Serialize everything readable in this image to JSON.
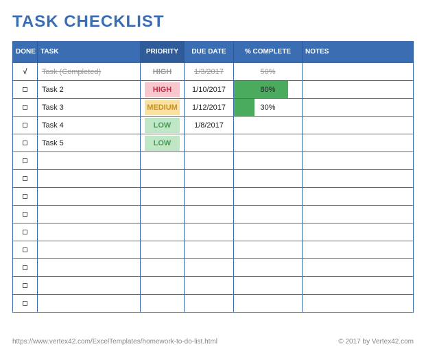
{
  "title": "TASK CHECKLIST",
  "columns": {
    "done": "DONE",
    "task": "TASK",
    "priority": "PRIORITY",
    "due": "DUE DATE",
    "pct": "% COMPLETE",
    "notes": "NOTES"
  },
  "rows": [
    {
      "done": true,
      "task": "Task (Completed)",
      "priority": "HIGH",
      "due": "1/3/2017",
      "pct": "50%",
      "pct_val": 50,
      "notes": ""
    },
    {
      "done": false,
      "task": "Task 2",
      "priority": "HIGH",
      "due": "1/10/2017",
      "pct": "80%",
      "pct_val": 80,
      "notes": ""
    },
    {
      "done": false,
      "task": "Task 3",
      "priority": "MEDIUM",
      "due": "1/12/2017",
      "pct": "30%",
      "pct_val": 30,
      "notes": ""
    },
    {
      "done": false,
      "task": "Task 4",
      "priority": "LOW",
      "due": "1/8/2017",
      "pct": "",
      "pct_val": 0,
      "notes": ""
    },
    {
      "done": false,
      "task": "Task 5",
      "priority": "LOW",
      "due": "",
      "pct": "",
      "pct_val": 0,
      "notes": ""
    },
    {
      "done": false,
      "task": "",
      "priority": "",
      "due": "",
      "pct": "",
      "pct_val": 0,
      "notes": ""
    },
    {
      "done": false,
      "task": "",
      "priority": "",
      "due": "",
      "pct": "",
      "pct_val": 0,
      "notes": ""
    },
    {
      "done": false,
      "task": "",
      "priority": "",
      "due": "",
      "pct": "",
      "pct_val": 0,
      "notes": ""
    },
    {
      "done": false,
      "task": "",
      "priority": "",
      "due": "",
      "pct": "",
      "pct_val": 0,
      "notes": ""
    },
    {
      "done": false,
      "task": "",
      "priority": "",
      "due": "",
      "pct": "",
      "pct_val": 0,
      "notes": ""
    },
    {
      "done": false,
      "task": "",
      "priority": "",
      "due": "",
      "pct": "",
      "pct_val": 0,
      "notes": ""
    },
    {
      "done": false,
      "task": "",
      "priority": "",
      "due": "",
      "pct": "",
      "pct_val": 0,
      "notes": ""
    },
    {
      "done": false,
      "task": "",
      "priority": "",
      "due": "",
      "pct": "",
      "pct_val": 0,
      "notes": ""
    },
    {
      "done": false,
      "task": "",
      "priority": "",
      "due": "",
      "pct": "",
      "pct_val": 0,
      "notes": ""
    }
  ],
  "priority_classes": {
    "HIGH": "pri-high",
    "MEDIUM": "pri-medium",
    "LOW": "pri-low"
  },
  "footer": {
    "url": "https://www.vertex42.com/ExcelTemplates/homework-to-do-list.html",
    "copyright": "© 2017 by Vertex42.com"
  }
}
